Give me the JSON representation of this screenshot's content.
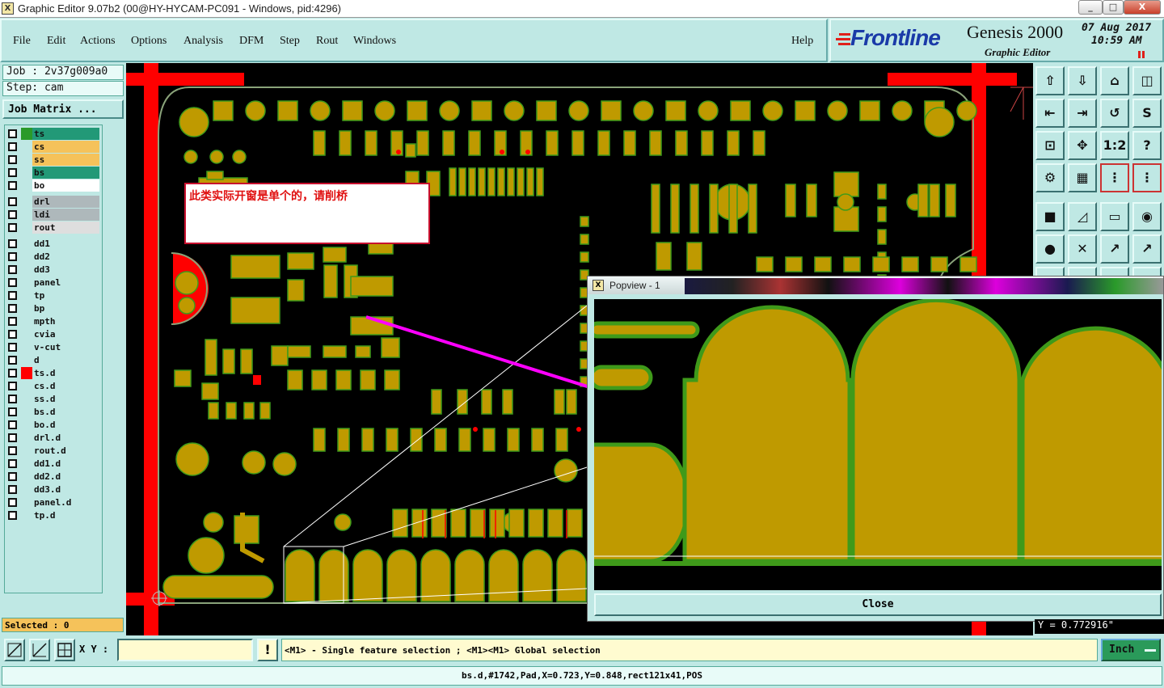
{
  "window": {
    "title": "Graphic Editor 9.07b2 (00@HY-HYCAM-PC091 - Windows, pid:4296)",
    "icon_glyph": "X",
    "min": "_",
    "max": "□",
    "close": "X"
  },
  "menu": [
    "File",
    "Edit",
    "Actions",
    "Options",
    "Analysis",
    "DFM",
    "Step",
    "Rout",
    "Windows"
  ],
  "help": "Help",
  "brand": {
    "logo": "Frontline",
    "product": "Genesis 2000",
    "subtitle": "Graphic Editor",
    "date": "07 Aug 2017",
    "time": "10:59 AM"
  },
  "job": "Job : 2v37g009a0",
  "step": "Step: cam",
  "job_matrix": "Job Matrix ...",
  "layers_group1": [
    {
      "name": "ts",
      "color": "#229977"
    },
    {
      "name": "cs",
      "color": "#f5c25a"
    },
    {
      "name": "ss",
      "color": "#f5c25a"
    },
    {
      "name": "bs",
      "color": "#229977"
    },
    {
      "name": "bo",
      "color": "#ffffff"
    }
  ],
  "layers_group2": [
    {
      "name": "drl",
      "color": "#aeb8bb"
    },
    {
      "name": "ldi",
      "color": "#aeb8bb"
    },
    {
      "name": "rout",
      "color": "#dedede"
    }
  ],
  "layers_group3": [
    "dd1",
    "dd2",
    "dd3",
    "panel",
    "tp",
    "bp",
    "mpth",
    "cvia",
    "v-cut",
    "d",
    "ts.d",
    "cs.d",
    "ss.d",
    "bs.d",
    "bo.d",
    "drl.d",
    "rout.d",
    "dd1.d",
    "dd2.d",
    "dd3.d",
    "panel.d",
    "tp.d"
  ],
  "selected": "Selected : 0",
  "annotation": "此类实际开窗是单个的，请削桥",
  "popview": {
    "title": "Popview - 1",
    "close": "Close"
  },
  "coord_readout": "Y = 0.772916\"",
  "xy_label": "X Y :",
  "xy_value": "",
  "exclaim": "!",
  "hint": "<M1> - Single feature selection ; <M1><M1> Global selection",
  "units": "Inch",
  "status": "bs.d,#1742,Pad,X=0.723,Y=0.848,rect121x41,POS",
  "colors": {
    "copper": "#bf9a00",
    "outline": "#3f9a1a",
    "frame": "#ff0000",
    "background": "#bfe8e4",
    "arrow": "#ff00ff"
  }
}
